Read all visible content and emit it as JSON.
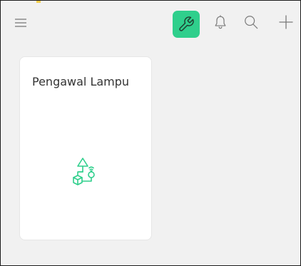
{
  "toolbar": {
    "accent_color": "#2fcf8c",
    "icons": {
      "menu": "hamburger-menu-icon",
      "tool": "wrench-icon",
      "notifications": "bell-icon",
      "search": "search-icon",
      "add": "plus-icon"
    }
  },
  "cards": [
    {
      "title": "Pengawal Lampu",
      "icon": "flow-diagram-icon",
      "icon_color": "#2fcf8c"
    }
  ]
}
